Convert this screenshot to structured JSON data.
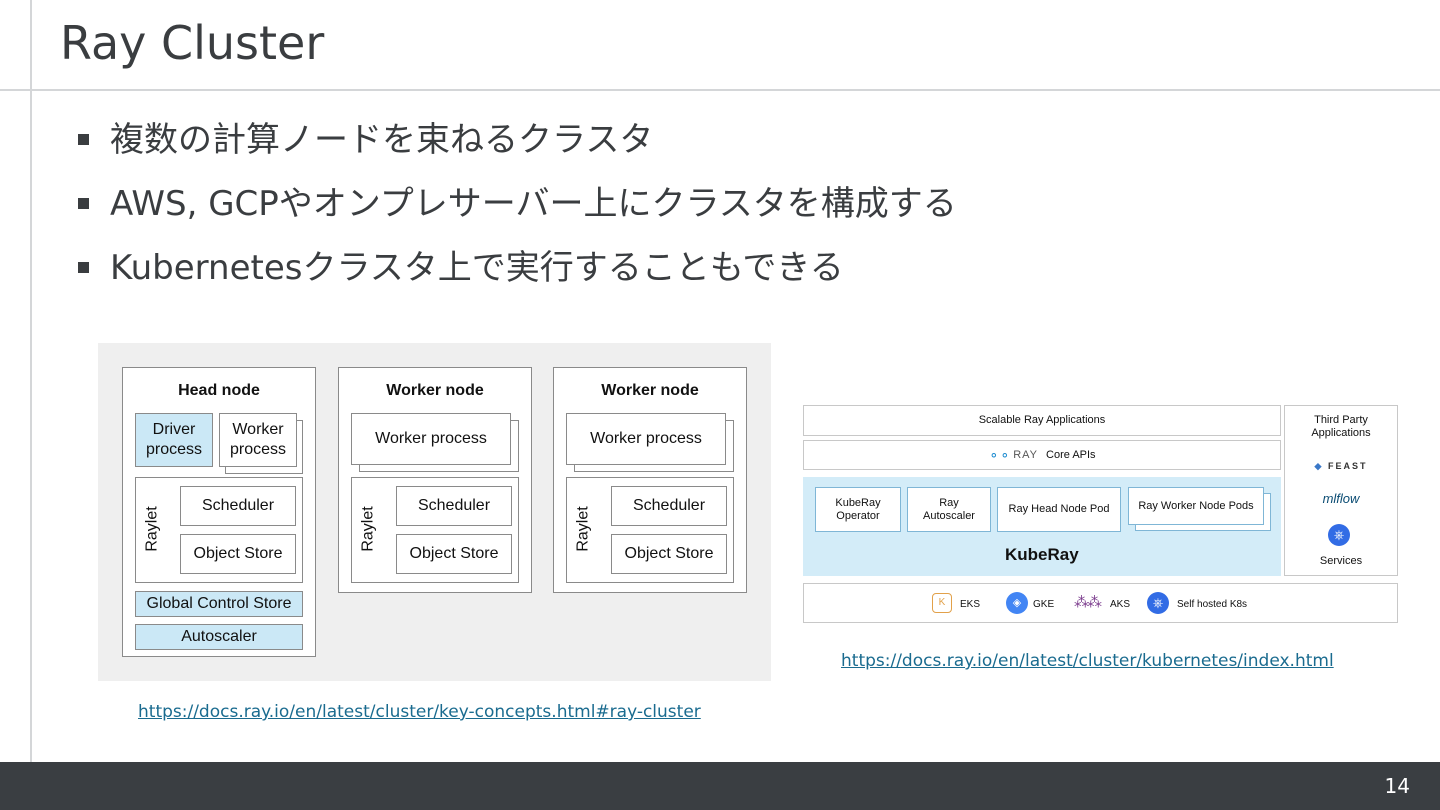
{
  "slide": {
    "title": "Ray Cluster",
    "bullets": [
      "複数の計算ノードを束ねるクラスタ",
      "AWS, GCPやオンプレサーバー上にクラスタを構成する",
      "Kubernetesクラスタ上で実行することもできる"
    ],
    "page_number": "14"
  },
  "diagram_left": {
    "head_node": {
      "title": "Head node",
      "driver_process": "Driver\nprocess",
      "worker_process": "Worker\nprocess",
      "raylet": "Raylet",
      "scheduler": "Scheduler",
      "object_store": "Object Store",
      "gcs": "Global Control Store",
      "autoscaler": "Autoscaler"
    },
    "worker_nodes": [
      {
        "title": "Worker node",
        "worker_process": "Worker process",
        "raylet": "Raylet",
        "scheduler": "Scheduler",
        "object_store": "Object Store"
      },
      {
        "title": "Worker node",
        "worker_process": "Worker process",
        "raylet": "Raylet",
        "scheduler": "Scheduler",
        "object_store": "Object Store"
      }
    ],
    "link": "https://docs.ray.io/en/latest/cluster/key-concepts.html#ray-cluster"
  },
  "diagram_right": {
    "apps": "Scalable Ray Applications",
    "ray_logo": "RAY",
    "core_apis": "Core APIs",
    "third_party": "Third Party\nApplications",
    "feast": "FEAST",
    "mlflow": "mlflow",
    "services": "Services",
    "kuberay_operator": "KubeRay\nOperator",
    "ray_autoscaler": "Ray\nAutoscaler",
    "head_pod": "Ray Head Node Pod",
    "worker_pods": "Ray Worker Node Pods",
    "kuberay": "KubeRay",
    "platforms": [
      "EKS",
      "GKE",
      "AKS",
      "Self hosted K8s"
    ],
    "link": "https://docs.ray.io/en/latest/cluster/kubernetes/index.html"
  },
  "colors": {
    "accent_blue": "#cbe8f6",
    "footer": "#3a3e42",
    "link": "#1a6b8f"
  }
}
